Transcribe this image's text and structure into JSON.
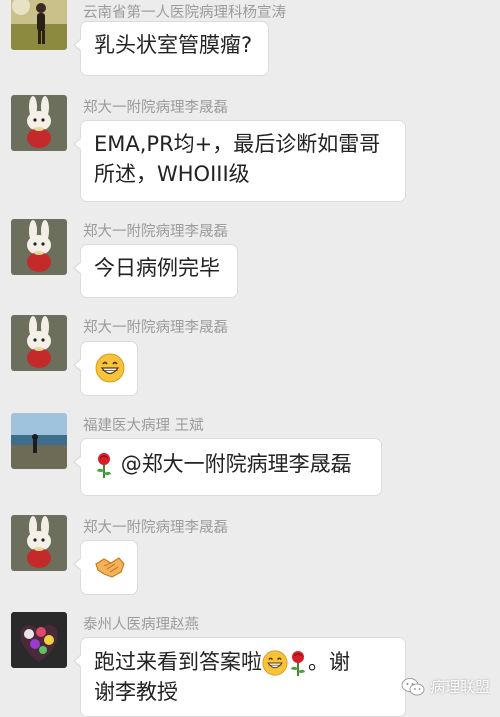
{
  "messages": [
    {
      "sender": "云南省第一人医院病理科杨宣涛",
      "avatar": "person-photo-avatar",
      "text": "乳头状室管膜瘤?"
    },
    {
      "sender": "郑大一附院病理李晟磊",
      "avatar": "bunny-plush-avatar",
      "line1": "EMA,PR均+，最后诊断如雷哥",
      "line2": "所述，WHOIII级"
    },
    {
      "sender": "郑大一附院病理李晟磊",
      "avatar": "bunny-plush-avatar",
      "text": "今日病例完毕"
    },
    {
      "sender": "郑大一附院病理李晟磊",
      "avatar": "bunny-plush-avatar",
      "emoji": "grin-emoji"
    },
    {
      "sender": "福建医大病理 王斌",
      "avatar": "beach-photo-avatar",
      "text": "@郑大一附院病理李晟磊",
      "emoji": "rose-emoji"
    },
    {
      "sender": "郑大一附院病理李晟磊",
      "avatar": "bunny-plush-avatar",
      "emoji": "handshake-emoji"
    },
    {
      "sender": "泰州人医病理赵燕",
      "avatar": "flower-photo-avatar",
      "line1_a": "跑过来看到答案啦",
      "line1_b": "。谢",
      "line2": "谢李教授"
    }
  ],
  "watermark": {
    "text": "病理联盟",
    "icon": "wechat-icon"
  }
}
